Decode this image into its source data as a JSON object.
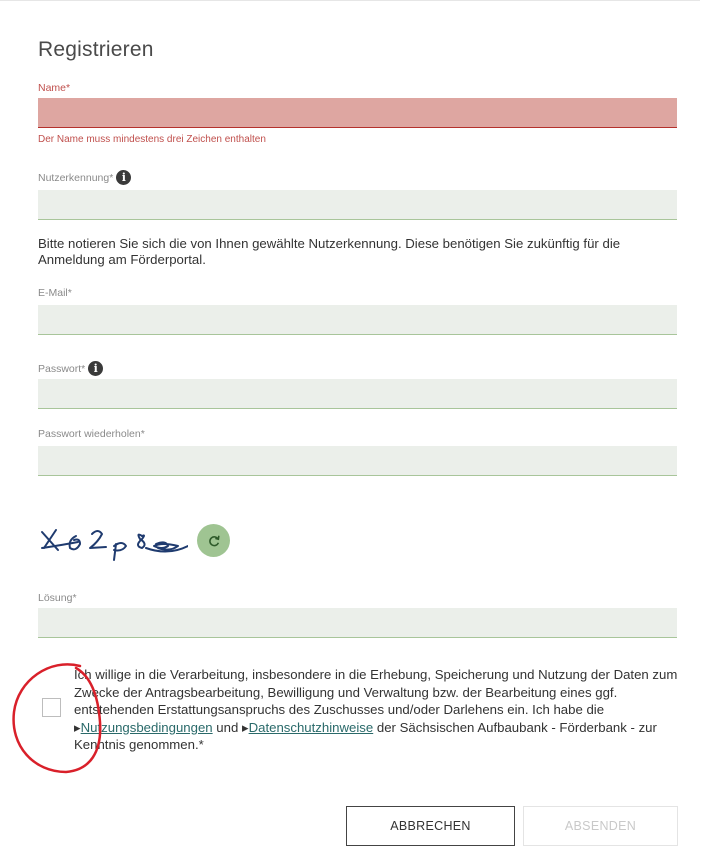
{
  "form": {
    "title": "Registrieren",
    "name": {
      "label": "Name*",
      "value": "",
      "error": "Der Name muss mindestens drei Zeichen enthalten"
    },
    "username": {
      "label": "Nutzerkennung*",
      "value": ""
    },
    "username_note": "Bitte notieren Sie sich die von Ihnen gewählte Nutzerkennung. Diese benötigen Sie zukünftig für die Anmeldung am Förderportal.",
    "email": {
      "label": "E-Mail*",
      "value": ""
    },
    "password": {
      "label": "Passwort*",
      "value": ""
    },
    "password_repeat": {
      "label": "Passwort wiederholen*",
      "value": ""
    },
    "captcha": {
      "text": "x62p8e",
      "refresh_icon": "refresh-icon"
    },
    "solution": {
      "label": "Lösung*",
      "value": ""
    },
    "consent": {
      "checked": false,
      "text_before": "Ich willige in die Verarbeitung, insbesondere in die Erhebung, Speicherung und Nutzung der Daten zum Zwecke der Antragsbearbeitung, Bewilligung und Verwaltung bzw. der Bearbeitung eines ggf. entstehenden Erstattungsanspruchs des Zuschusses und/oder Darlehens ein. Ich habe die ",
      "link1": "Nutzungsbedingungen",
      "text_middle": " und ",
      "link2": "Datenschutzhinweise",
      "text_after": " der Sächsischen Aufbaubank - Förderbank - zur Kenntnis genommen.*"
    },
    "buttons": {
      "cancel": "ABBRECHEN",
      "submit": "ABSENDEN"
    },
    "info_icon": "i"
  },
  "colors": {
    "field_bg": "#ebefea",
    "field_border": "#a8c59a",
    "error_bg": "#dea6a1",
    "error_text": "#c0504d",
    "accent_green": "#9fc492",
    "annotation_red": "#d9202a"
  }
}
